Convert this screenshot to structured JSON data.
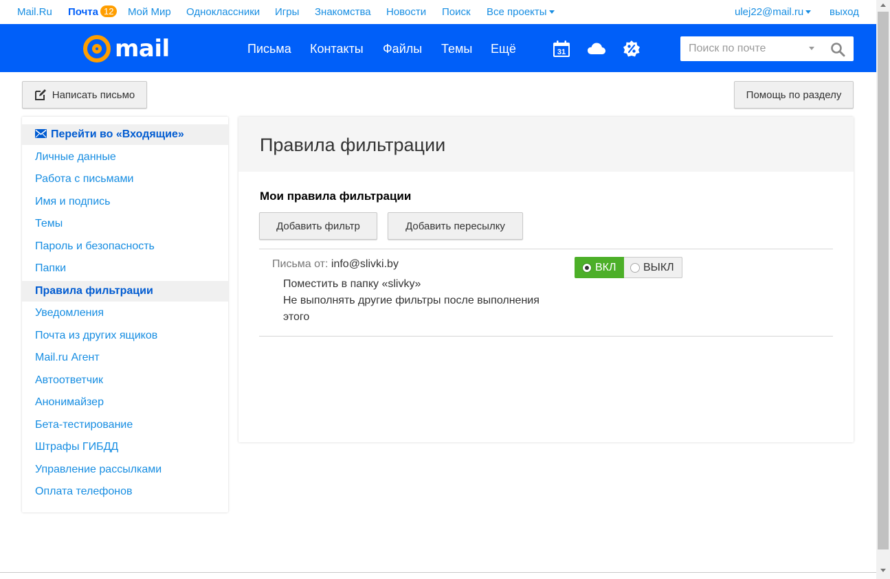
{
  "portal": {
    "links": [
      "Mail.Ru",
      "Почта",
      "Мой Мир",
      "Одноклассники",
      "Игры",
      "Знакомства",
      "Новости",
      "Поиск",
      "Все проекты"
    ],
    "mail_badge": "12",
    "user": "ulej22@mail.ru",
    "logout": "выход"
  },
  "header": {
    "logo_text": "mail",
    "nav": [
      "Письма",
      "Контакты",
      "Файлы",
      "Темы",
      "Ещё"
    ],
    "calendar_day": "31",
    "search_placeholder": "Поиск по почте"
  },
  "toolbar": {
    "compose_label": "Написать письмо",
    "help_label": "Помощь по разделу"
  },
  "sidebar": {
    "inbox_link": "Перейти во «Входящие»",
    "items": [
      "Личные данные",
      "Работа с письмами",
      "Имя и подпись",
      "Темы",
      "Пароль и безопасность",
      "Папки",
      "Правила фильтрации",
      "Уведомления",
      "Почта из других ящиков",
      "Mail.ru Агент",
      "Автоответчик",
      "Анонимайзер",
      "Бета-тестирование",
      "Штрафы ГИБДД",
      "Управление рассылками",
      "Оплата телефонов"
    ],
    "selected": "Правила фильтрации"
  },
  "main": {
    "title": "Правила фильтрации",
    "subtitle": "Мои правила фильтрации",
    "add_filter": "Добавить фильтр",
    "add_forward": "Добавить пересылку",
    "rule": {
      "from_label": "Письма от:",
      "from_value": "info@slivki.by",
      "action1": "Поместить в папку «slivky»",
      "action2_line1": "Не выполнять другие фильтры после выполнения",
      "action2_line2": "этого",
      "on_label": "ВКЛ",
      "off_label": "ВЫКЛ",
      "state": "on"
    }
  },
  "colors": {
    "brand_blue": "#005ff9",
    "link_blue": "#168de2",
    "badge_orange": "#ff9e00",
    "toggle_green": "#4caf28"
  }
}
